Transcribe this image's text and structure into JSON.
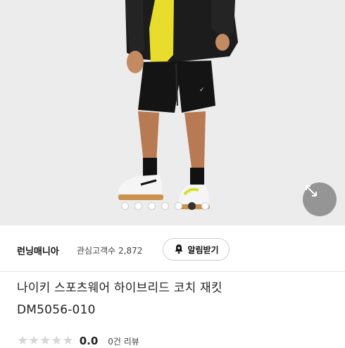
{
  "product_image": {
    "carousel_total": 7,
    "carousel_active_index": 5
  },
  "expand_button": {
    "icon": "expand-arrows-icon"
  },
  "store": {
    "name": "런닝매니아",
    "followers_label": "관심고객수 2,872",
    "alarm_button_label": "알림받기",
    "alarm_icon": "bell-plus-icon"
  },
  "product": {
    "title_line1": "나이키 스포츠웨어 하이브리드 코치 재킷",
    "title_line2": "DM5056-010"
  },
  "rating": {
    "stars_glyph": "★★★★★",
    "score": "0.0",
    "review_count_label": "0건 리뷰"
  },
  "colors": {
    "jacket": "#1c1c1c",
    "shirt": "#e8dc2c",
    "shorts": "#141414",
    "background": "#ececec"
  }
}
